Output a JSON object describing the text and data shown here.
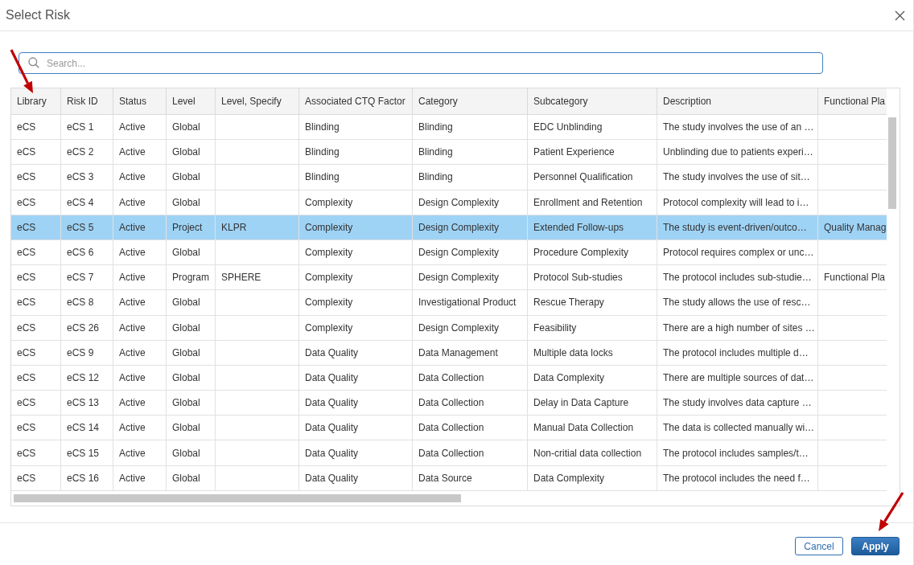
{
  "dialog": {
    "title": "Select Risk"
  },
  "search": {
    "placeholder": "Search..."
  },
  "table": {
    "columns": [
      "Library",
      "Risk ID",
      "Status",
      "Level",
      "Level, Specify",
      "Associated CTQ Factor",
      "Category",
      "Subcategory",
      "Description",
      "Functional Pla"
    ],
    "rows": [
      {
        "selected": false,
        "library": "eCS",
        "risk_id": "eCS 1",
        "status": "Active",
        "risk_level": "Global",
        "ctq_factor": "Blinding",
        "category": "Blinding",
        "subcategory": "EDC Unblinding",
        "description": "The study involves the use of an …"
      },
      {
        "selected": false,
        "library": "eCS",
        "risk_id": "eCS 2",
        "status": "Active",
        "risk_level": "Global",
        "ctq_factor": "Blinding",
        "category": "Blinding",
        "subcategory": "Patient Experience",
        "description": "Unblinding due to patients experi…"
      },
      {
        "selected": false,
        "library": "eCS",
        "risk_id": "eCS 3",
        "status": "Active",
        "risk_level": "Global",
        "ctq_factor": "Blinding",
        "category": "Blinding",
        "subcategory": "Personnel Qualification",
        "description": "The study involves the use of sit…"
      },
      {
        "selected": false,
        "library": "eCS",
        "risk_id": "eCS 4",
        "status": "Active",
        "risk_level": "Global",
        "ctq_factor": "Complexity",
        "category": "Design Complexity",
        "subcategory": "Enrollment and Retention",
        "description": "Protocol complexity will lead to i…"
      },
      {
        "selected": true,
        "library": "eCS",
        "risk_id": "eCS 5",
        "status": "Active",
        "risk_level": "Project",
        "risk_level_specify": "KLPR",
        "ctq_factor": "Complexity",
        "category": "Design Complexity",
        "subcategory": "Extended Follow-ups",
        "description": "The study is event-driven/outco…",
        "column_10": "Quality Manag"
      },
      {
        "selected": false,
        "library": "eCS",
        "risk_id": "eCS 6",
        "status": "Active",
        "risk_level": "Global",
        "ctq_factor": "Complexity",
        "category": "Design Complexity",
        "subcategory": "Procedure Complexity",
        "description": "Protocol requires complex or unc…"
      },
      {
        "selected": false,
        "library": "eCS",
        "risk_id": "eCS 7",
        "status": "Active",
        "risk_level": "Program",
        "risk_level_specify": "SPHERE",
        "ctq_factor": "Complexity",
        "category": "Design Complexity",
        "subcategory": "Protocol Sub-studies",
        "description": "The protocol includes sub-studie…",
        "column_10": "Functional Pla"
      },
      {
        "selected": false,
        "library": "eCS",
        "risk_id": "eCS 8",
        "status": "Active",
        "risk_level": "Global",
        "ctq_factor": "Complexity",
        "category": "Investigational Product",
        "subcategory": "Rescue Therapy",
        "description": "The study allows the use of resc…"
      },
      {
        "selected": false,
        "library": "eCS",
        "risk_id": "eCS 26",
        "status": "Active",
        "risk_level": "Global",
        "ctq_factor": "Complexity",
        "category": "Design Complexity",
        "subcategory": "Feasibility",
        "description": "There are a high number of sites …"
      },
      {
        "selected": false,
        "library": "eCS",
        "risk_id": "eCS 9",
        "status": "Active",
        "risk_level": "Global",
        "ctq_factor": "Data Quality",
        "category": "Data Management",
        "subcategory": "Multiple data locks",
        "description": "The protocol includes multiple d…"
      },
      {
        "selected": false,
        "library": "eCS",
        "risk_id": "eCS 12",
        "status": "Active",
        "risk_level": "Global",
        "ctq_factor": "Data Quality",
        "category": "Data Collection",
        "subcategory": "Data Complexity",
        "description": "There are multiple sources of dat…"
      },
      {
        "selected": false,
        "library": "eCS",
        "risk_id": "eCS 13",
        "status": "Active",
        "risk_level": "Global",
        "ctq_factor": "Data Quality",
        "category": "Data Collection",
        "subcategory": "Delay in Data Capture",
        "description": "The study involves data capture …"
      },
      {
        "selected": false,
        "library": "eCS",
        "risk_id": "eCS 14",
        "status": "Active",
        "risk_level": "Global",
        "ctq_factor": "Data Quality",
        "category": "Data Collection",
        "subcategory": "Manual Data Collection",
        "description": "The data is collected manually wi…"
      },
      {
        "selected": false,
        "library": "eCS",
        "risk_id": "eCS 15",
        "status": "Active",
        "risk_level": "Global",
        "ctq_factor": "Data Quality",
        "category": "Data Collection",
        "subcategory": "Non-critial data collection",
        "description": "The protocol includes samples/t…"
      },
      {
        "selected": false,
        "library": "eCS",
        "risk_id": "eCS 16",
        "status": "Active",
        "risk_level": "Global",
        "ctq_factor": "Data Quality",
        "category": "Data Source",
        "subcategory": "Data Complexity",
        "description": "The protocol includes the need f…"
      }
    ]
  },
  "buttons": [
    {
      "label": "Cancel",
      "kind": "secondary"
    },
    {
      "label": "Apply",
      "kind": "primary"
    }
  ]
}
